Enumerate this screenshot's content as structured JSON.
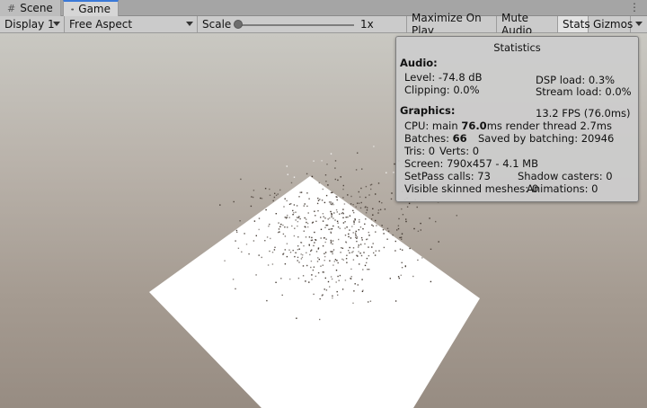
{
  "tabs": [
    {
      "label": "Scene",
      "icon": "grid-icon",
      "active": false
    },
    {
      "label": "Game",
      "icon": "gamepad-icon",
      "active": true
    }
  ],
  "toolbar": {
    "display": "Display 1",
    "aspect": "Free Aspect",
    "scale_label": "Scale",
    "scale_value": "1x",
    "scale_fraction": 0.0,
    "maximize": "Maximize On Play",
    "mute": "Mute Audio",
    "stats": "Stats",
    "gizmos": "Gizmos"
  },
  "stats": {
    "title": "Statistics",
    "audio_header": "Audio:",
    "level": "Level: -74.8 dB",
    "clipping": "Clipping: 0.0%",
    "dsp_load": "DSP load: 0.3%",
    "stream_load": "Stream load: 0.0%",
    "graphics_header": "Graphics:",
    "fps": "13.2 FPS (76.0ms)",
    "cpu_prefix": "CPU: main ",
    "cpu_main": "76.0",
    "cpu_suffix": "ms  render thread 2.7ms",
    "batches_prefix": "Batches: ",
    "batches": "66",
    "saved_batching": "Saved by batching: 20946",
    "tris": "Tris: 0",
    "verts": "Verts: 0",
    "screen": "Screen: 790x457 - 4.1 MB",
    "setpass": "SetPass calls: 73",
    "shadow_casters": "Shadow casters: 0",
    "skinned": "Visible skinned meshes: 0",
    "animations": "Animations: 0"
  },
  "colors": {
    "plane": "#ffffff",
    "particles": "#3a3028",
    "tab_accent": "#3a79d8"
  }
}
